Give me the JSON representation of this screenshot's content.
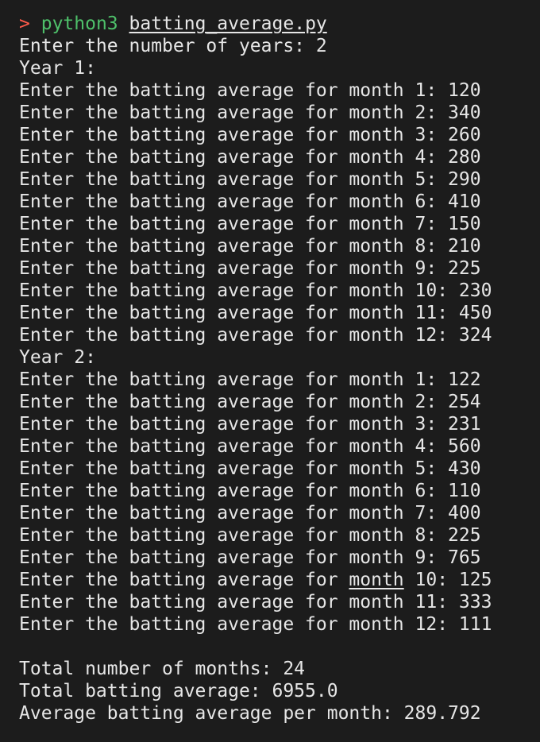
{
  "command": {
    "prompt": ">",
    "program": "python3",
    "script": "batting_average.py"
  },
  "years_prompt": "Enter the number of years: 2",
  "year1": {
    "header": "Year 1:",
    "lines": [
      "Enter the batting average for month 1: 120",
      "Enter the batting average for month 2: 340",
      "Enter the batting average for month 3: 260",
      "Enter the batting average for month 4: 280",
      "Enter the batting average for month 5: 290",
      "Enter the batting average for month 6: 410",
      "Enter the batting average for month 7: 150",
      "Enter the batting average for month 8: 210",
      "Enter the batting average for month 9: 225",
      "Enter the batting average for month 10: 230",
      "Enter the batting average for month 11: 450",
      "Enter the batting average for month 12: 324"
    ]
  },
  "year2": {
    "header": "Year 2:",
    "lines": [
      "Enter the batting average for month 1: 122",
      "Enter the batting average for month 2: 254",
      "Enter the batting average for month 3: 231",
      "Enter the batting average for month 4: 560",
      "Enter the batting average for month 5: 430",
      "Enter the batting average for month 6: 110",
      "Enter the batting average for month 7: 400",
      "Enter the batting average for month 8: 225",
      "Enter the batting average for month 9: 765"
    ],
    "line10": {
      "before": "Enter the batting average for ",
      "underlined": "month",
      "after": " 10: 125"
    },
    "lines_end": [
      "Enter the batting average for month 11: 333",
      "Enter the batting average for month 12: 111"
    ]
  },
  "summary": {
    "total_months": "Total number of months: 24",
    "total_average": "Total batting average: 6955.0",
    "average_per_month": "Average batting average per month: 289.792"
  }
}
